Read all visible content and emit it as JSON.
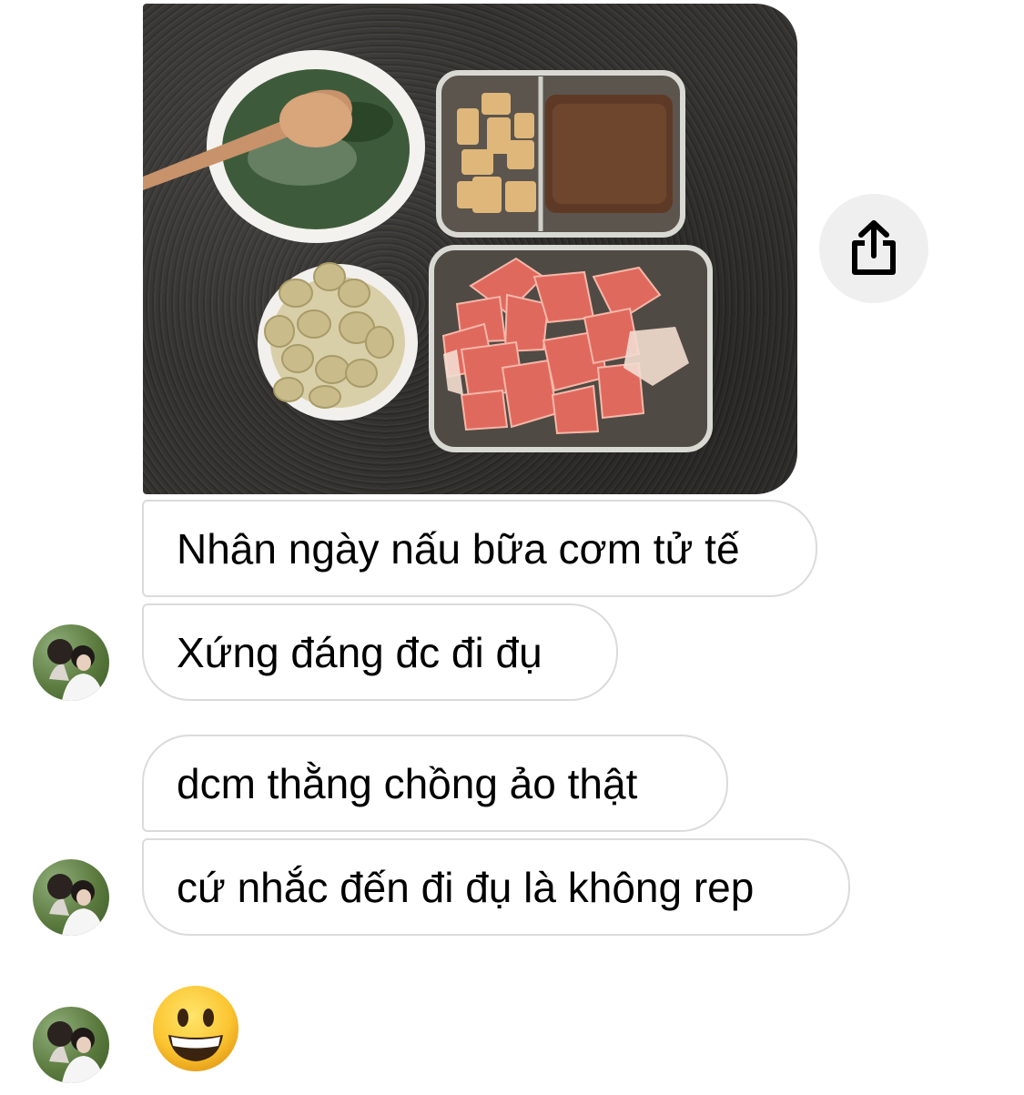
{
  "thread": {
    "messages": [
      {
        "type": "image",
        "alt_icons": [
          "soup-bowl",
          "tofu-meat-container",
          "nuts-bowl",
          "watermelon-container"
        ]
      },
      {
        "type": "text",
        "text": "Nhân ngày nấu bữa cơm tử tế"
      },
      {
        "type": "text",
        "text": "Xứng đáng đc đi đụ"
      },
      {
        "type": "text",
        "text": "dcm thằng chồng ảo thật"
      },
      {
        "type": "text",
        "text": "cứ nhắc đến đi đụ là không rep"
      },
      {
        "type": "emoji",
        "emoji": "grinning-face"
      }
    ]
  },
  "actions": {
    "share_icon": "share-icon"
  },
  "colors": {
    "bubble_border": "#dbdbdb",
    "share_bg": "#efefef",
    "counter": "#312f2c"
  }
}
